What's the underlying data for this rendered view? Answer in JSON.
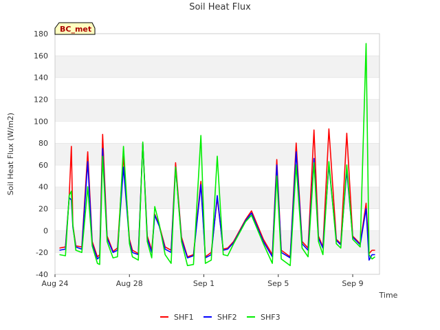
{
  "chart_data": {
    "type": "line",
    "title": "Soil Heat Flux",
    "xlabel": "Time",
    "ylabel": "Soil Heat Flux (W/m2)",
    "site_label": "BC_met",
    "ylim": [
      -40,
      180
    ],
    "xlim": [
      0,
      21.8
    ],
    "x_unit": "days since Aug 24",
    "yticks": [
      -40,
      -20,
      0,
      20,
      40,
      60,
      80,
      100,
      120,
      140,
      160,
      180
    ],
    "xticks": [
      {
        "x": 0,
        "label": "Aug 24"
      },
      {
        "x": 5,
        "label": "Aug 28"
      },
      {
        "x": 10,
        "label": "Sep 1"
      },
      {
        "x": 15,
        "label": "Sep 5"
      },
      {
        "x": 20,
        "label": "Sep 9"
      }
    ],
    "grid": "horizontal bands",
    "legend_position": "bottom",
    "series": [
      {
        "name": "SHF1",
        "color": "#ff0000",
        "x": [
          0.3,
          0.7,
          0.95,
          1.1,
          1.2,
          1.4,
          1.8,
          2.2,
          2.5,
          2.85,
          3.0,
          3.2,
          3.5,
          3.9,
          4.2,
          4.6,
          5.0,
          5.2,
          5.6,
          5.9,
          6.2,
          6.5,
          6.7,
          7.0,
          7.4,
          7.8,
          8.1,
          8.5,
          8.9,
          9.3,
          9.8,
          10.1,
          10.5,
          10.9,
          11.3,
          11.6,
          12.0,
          12.4,
          12.8,
          13.2,
          14.0,
          14.6,
          14.9,
          15.2,
          15.8,
          16.2,
          16.6,
          17.0,
          17.4,
          17.7,
          18.0,
          18.4,
          18.9,
          19.2,
          19.6,
          20.0,
          20.5,
          20.9,
          21.1,
          21.3,
          21.5
        ],
        "y": [
          -16,
          -15,
          30,
          77,
          5,
          -14,
          -15,
          72,
          -10,
          -24,
          -22,
          88,
          -5,
          -19,
          -16,
          68,
          -8,
          -18,
          -21,
          80,
          -5,
          -18,
          15,
          5,
          -15,
          -18,
          62,
          -6,
          -24,
          -22,
          45,
          -24,
          -20,
          30,
          -17,
          -16,
          -10,
          0,
          10,
          18,
          -8,
          -22,
          65,
          -18,
          -24,
          80,
          -10,
          -16,
          92,
          -5,
          -15,
          93,
          -8,
          -12,
          89,
          -5,
          -12,
          25,
          -21,
          -18,
          -18
        ]
      },
      {
        "name": "SHF2",
        "color": "#0000ff",
        "x": [
          0.3,
          0.7,
          0.95,
          1.1,
          1.2,
          1.4,
          1.8,
          2.2,
          2.5,
          2.85,
          3.0,
          3.2,
          3.5,
          3.9,
          4.2,
          4.6,
          5.0,
          5.2,
          5.6,
          5.9,
          6.2,
          6.5,
          6.7,
          7.0,
          7.4,
          7.8,
          8.1,
          8.5,
          8.9,
          9.3,
          9.8,
          10.1,
          10.5,
          10.9,
          11.3,
          11.6,
          12.0,
          12.4,
          12.8,
          13.2,
          14.0,
          14.6,
          14.9,
          15.2,
          15.8,
          16.2,
          16.6,
          17.0,
          17.4,
          17.7,
          18.0,
          18.4,
          18.9,
          19.2,
          19.6,
          20.0,
          20.5,
          20.9,
          21.1,
          21.3,
          21.5
        ],
        "y": [
          -18,
          -17,
          30,
          28,
          3,
          -15,
          -17,
          63,
          -12,
          -26,
          -24,
          75,
          -7,
          -20,
          -18,
          58,
          -10,
          -20,
          -22,
          80,
          -7,
          -20,
          14,
          4,
          -17,
          -20,
          58,
          -8,
          -25,
          -23,
          42,
          -25,
          -22,
          32,
          -18,
          -17,
          -11,
          -1,
          9,
          16,
          -10,
          -24,
          60,
          -20,
          -25,
          72,
          -12,
          -18,
          66,
          -7,
          -16,
          60,
          -9,
          -13,
          55,
          -6,
          -13,
          20,
          -27,
          -22,
          -22
        ]
      },
      {
        "name": "SHF3",
        "color": "#00ee00",
        "x": [
          0.3,
          0.7,
          0.95,
          1.1,
          1.2,
          1.4,
          1.8,
          2.2,
          2.5,
          2.85,
          3.0,
          3.2,
          3.5,
          3.9,
          4.2,
          4.6,
          5.0,
          5.2,
          5.6,
          5.9,
          6.2,
          6.5,
          6.7,
          7.0,
          7.4,
          7.8,
          8.1,
          8.5,
          8.9,
          9.3,
          9.8,
          10.1,
          10.5,
          10.9,
          11.3,
          11.6,
          12.0,
          12.4,
          12.8,
          13.2,
          14.0,
          14.6,
          14.9,
          15.2,
          15.8,
          16.2,
          16.6,
          17.0,
          17.4,
          17.7,
          18.0,
          18.4,
          18.9,
          19.2,
          19.6,
          20.0,
          20.5,
          20.9,
          21.1,
          21.3,
          21.5
        ],
        "y": [
          -22,
          -23,
          32,
          36,
          5,
          -18,
          -20,
          40,
          -14,
          -30,
          -31,
          68,
          -10,
          -25,
          -24,
          77,
          -12,
          -24,
          -27,
          81,
          -10,
          -25,
          22,
          6,
          -22,
          -30,
          58,
          -10,
          -32,
          -31,
          87,
          -30,
          -27,
          68,
          -22,
          -23,
          -12,
          -2,
          8,
          14,
          -12,
          -30,
          50,
          -26,
          -32,
          60,
          -16,
          -24,
          62,
          -10,
          -22,
          63,
          -12,
          -16,
          60,
          -8,
          -15,
          171,
          -22,
          -26,
          -24
        ]
      }
    ]
  }
}
